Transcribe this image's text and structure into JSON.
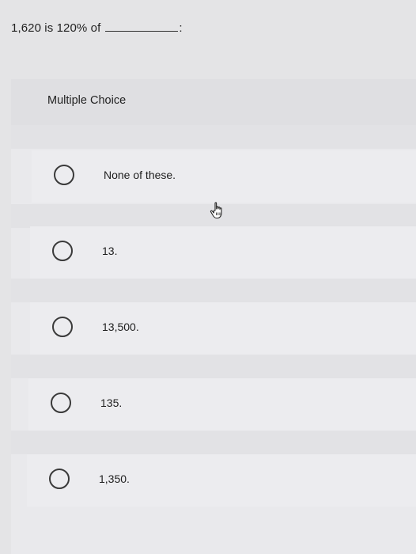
{
  "question": {
    "prefix": "1,620 is 120% of",
    "suffix": ":"
  },
  "mc": {
    "label": "Multiple Choice",
    "options": [
      {
        "label": "None of these."
      },
      {
        "label": "13."
      },
      {
        "label": "13,500."
      },
      {
        "label": "135."
      },
      {
        "label": "1,350."
      }
    ]
  },
  "cursor_icon": "pointing-hand-cursor-icon"
}
